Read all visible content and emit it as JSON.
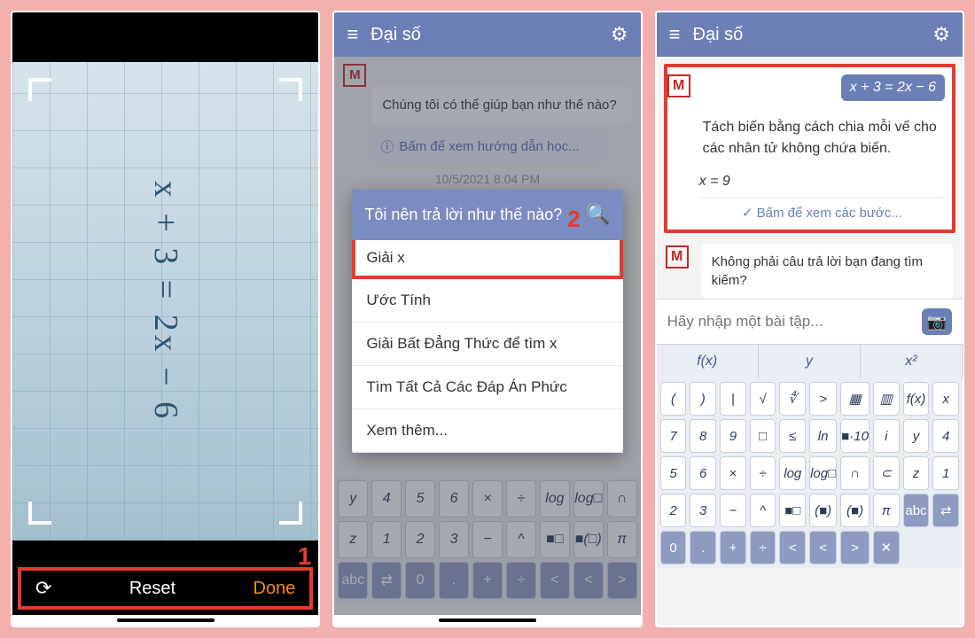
{
  "panel1": {
    "equation_handwritten": "x + 3 = 2x − 6",
    "step_marker": "1",
    "reset_label": "Reset",
    "done_label": "Done"
  },
  "panel2": {
    "header_title": "Đại số",
    "help_text": "Chúng tôi có thể giúp bạn như thế nào?",
    "tutorial_link": "Bấm để xem hướng dẫn học...",
    "timestamp": "10/5/2021 8:04 PM",
    "modal_title": "Tôi nên trả lời như thế nào?",
    "step_marker": "2",
    "options": [
      "Giải x",
      "Ước Tính",
      "Giải Bất Đẳng Thức để tìm x",
      "Tìm Tất Cả Các Đáp Án Phức",
      "Xem thêm..."
    ],
    "kbd_rows": [
      [
        "y",
        "4",
        "5",
        "6",
        "×",
        "÷",
        "log",
        "log□",
        "∩"
      ],
      [
        "z",
        "1",
        "2",
        "3",
        "−",
        "^",
        "■□",
        "■(□)",
        "π"
      ],
      [
        "abc",
        "⇄",
        "0",
        ".",
        "+",
        "÷",
        "<",
        "<",
        ">"
      ]
    ]
  },
  "panel3": {
    "header_title": "Đại số",
    "equation": "x + 3 = 2x − 6",
    "explanation": "Tách biến bằng cách chia mỗi vế cho các nhân tử không chứa biến.",
    "solution": "x = 9",
    "steps_link": "Bấm để xem các bước...",
    "followup": "Không phải câu trả lời bạn đang tìm kiếm?",
    "input_placeholder": "Hãy nhập một bài tập...",
    "tabs": [
      "f(x)",
      "y",
      "x²"
    ],
    "kbd_rows": [
      [
        "(",
        ")",
        "|",
        "√",
        "∜",
        ">",
        "▦",
        "▥",
        "f(x)"
      ],
      [
        "x",
        "7",
        "8",
        "9",
        "□",
        "≤",
        "ln",
        "■·10",
        "i"
      ],
      [
        "y",
        "4",
        "5",
        "6",
        "×",
        "÷",
        "log",
        "log□",
        "∩",
        "⊂"
      ],
      [
        "z",
        "1",
        "2",
        "3",
        "−",
        "^",
        "■□",
        "(■)",
        "(■)",
        "π"
      ],
      [
        "abc",
        "⇄",
        "0",
        ".",
        "+",
        "÷",
        "<",
        "<",
        ">",
        "✕"
      ]
    ]
  }
}
